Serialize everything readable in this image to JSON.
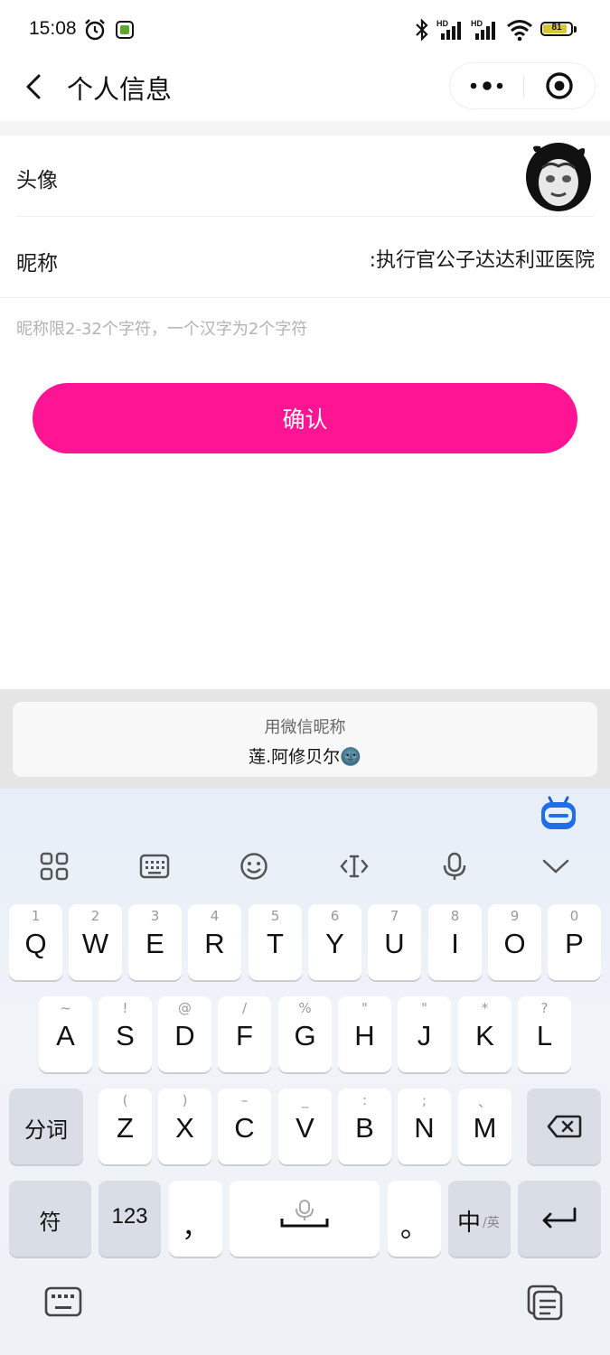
{
  "status_bar": {
    "time": "15:08",
    "battery": "81"
  },
  "nav": {
    "title": "个人信息"
  },
  "form": {
    "avatar_label": "头像",
    "nickname_label": "昵称",
    "nickname_value": ":执行官公子达达利亚医院",
    "hint": "昵称限2-32个字符，一个汉字为2个字符",
    "confirm_label": "确认"
  },
  "suggestion": {
    "title": "用微信昵称",
    "name": "莲.阿修贝尔🌚"
  },
  "keyboard": {
    "row1": [
      {
        "hint": "1",
        "key": "Q"
      },
      {
        "hint": "2",
        "key": "W"
      },
      {
        "hint": "3",
        "key": "E"
      },
      {
        "hint": "4",
        "key": "R"
      },
      {
        "hint": "5",
        "key": "T"
      },
      {
        "hint": "6",
        "key": "Y"
      },
      {
        "hint": "7",
        "key": "U"
      },
      {
        "hint": "8",
        "key": "I"
      },
      {
        "hint": "9",
        "key": "O"
      },
      {
        "hint": "0",
        "key": "P"
      }
    ],
    "row2": [
      {
        "hint": "~",
        "key": "A"
      },
      {
        "hint": "!",
        "key": "S"
      },
      {
        "hint": "@",
        "key": "D"
      },
      {
        "hint": "/",
        "key": "F"
      },
      {
        "hint": "%",
        "key": "G"
      },
      {
        "hint": "\"",
        "key": "H"
      },
      {
        "hint": "\"",
        "key": "J"
      },
      {
        "hint": "*",
        "key": "K"
      },
      {
        "hint": "?",
        "key": "L"
      }
    ],
    "row3": [
      {
        "hint": "(",
        "key": "Z"
      },
      {
        "hint": ")",
        "key": "X"
      },
      {
        "hint": "–",
        "key": "C"
      },
      {
        "hint": "_",
        "key": "V"
      },
      {
        "hint": ":",
        "key": "B"
      },
      {
        "hint": ";",
        "key": "N"
      },
      {
        "hint": "、",
        "key": "M"
      }
    ],
    "fenci": "分词",
    "fu": "符",
    "num": "123",
    "comma": "，",
    "period": "。",
    "zhong": "中",
    "ying": "/英"
  },
  "colors": {
    "accent": "#ff1493",
    "keyboard_bg": "#e6eef8"
  }
}
